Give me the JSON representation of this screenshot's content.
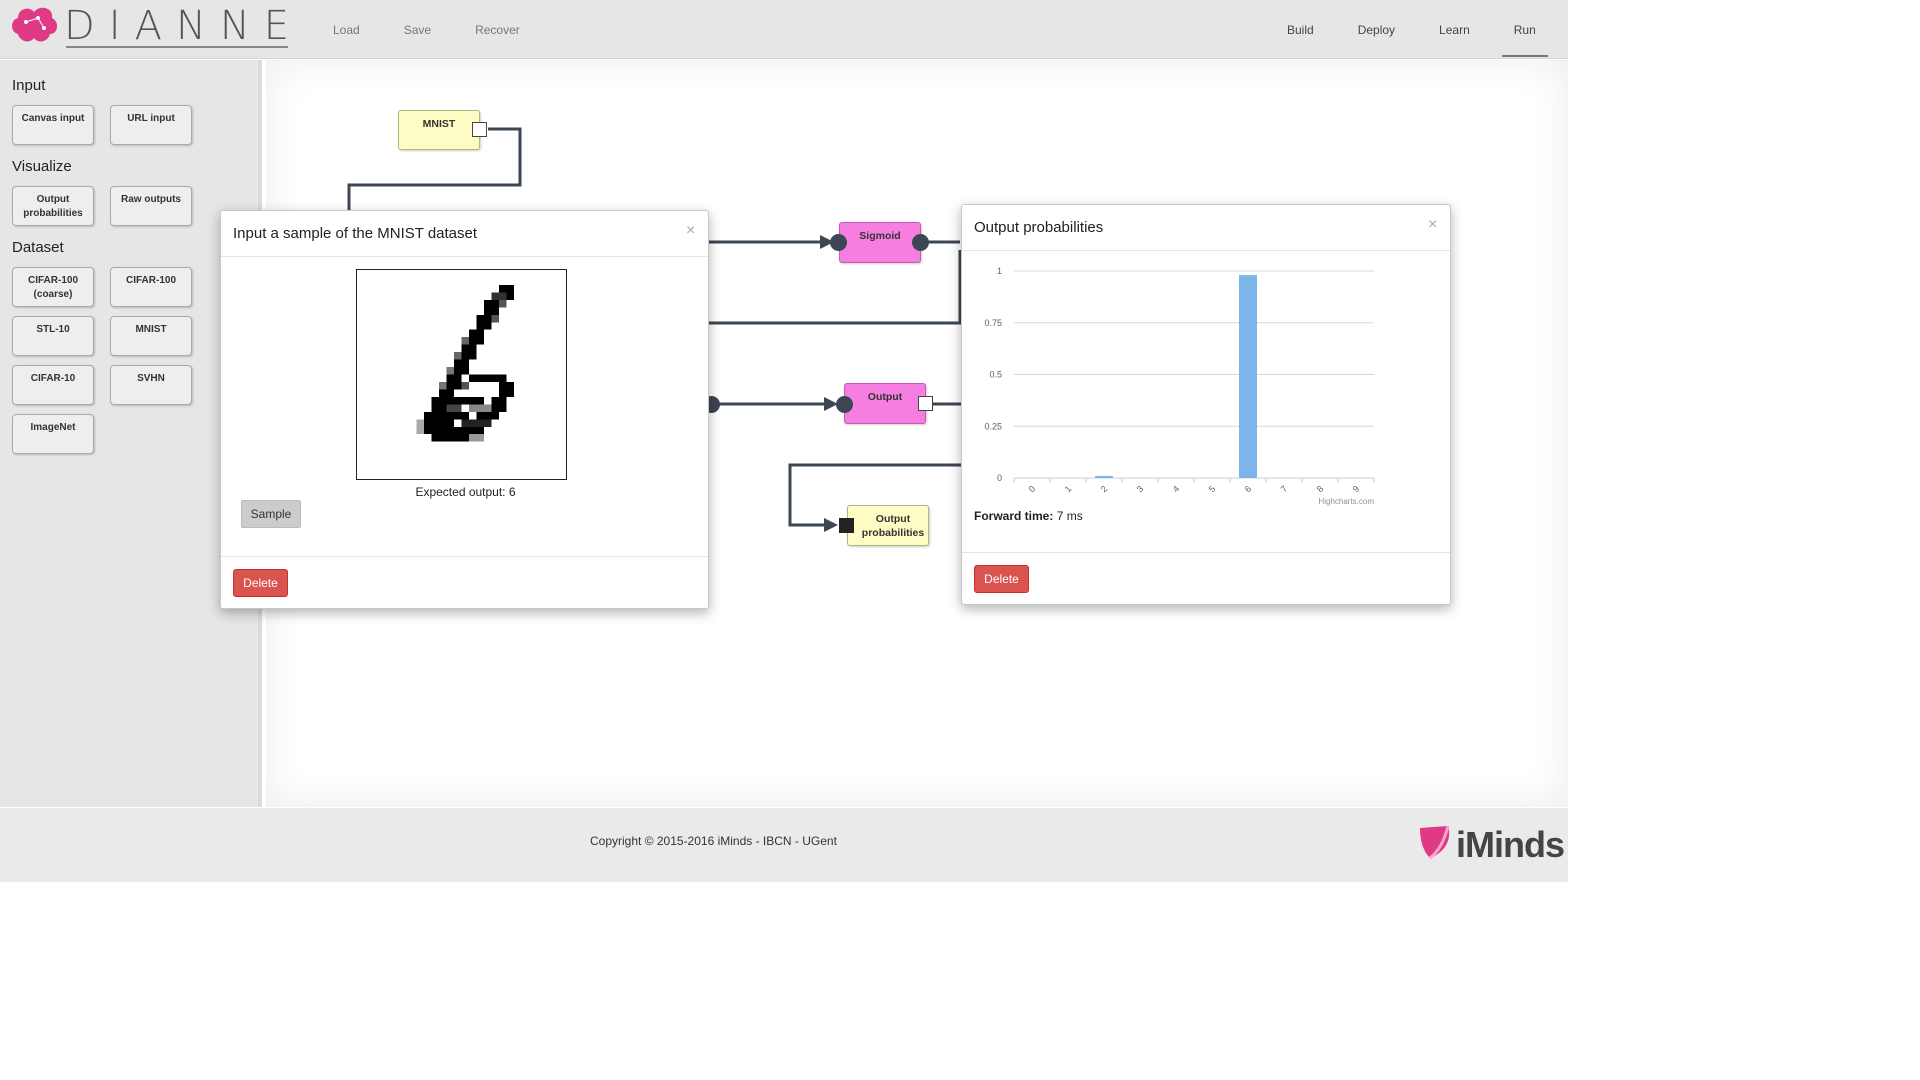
{
  "app": {
    "name": "DIANNE"
  },
  "nav": {
    "left": [
      "Load",
      "Save",
      "Recover"
    ],
    "right": [
      "Build",
      "Deploy",
      "Learn",
      "Run"
    ],
    "active": "Run"
  },
  "sidebar": {
    "sections": [
      {
        "title": "Input",
        "items": [
          "Canvas input",
          "URL input"
        ]
      },
      {
        "title": "Visualize",
        "items": [
          "Output probabilities",
          "Raw outputs"
        ]
      },
      {
        "title": "Dataset",
        "items": [
          "CIFAR-100 (coarse)",
          "CIFAR-100",
          "STL-10",
          "MNIST",
          "CIFAR-10",
          "SVHN",
          "ImageNet"
        ]
      }
    ]
  },
  "canvas": {
    "nodes": {
      "mnist": "MNIST",
      "sigmoid": "Sigmoid",
      "output": "Output",
      "output_prob": "Output probabilities"
    }
  },
  "sample_modal": {
    "title": "Input a sample of the MNIST dataset",
    "close": "×",
    "expected": "Expected output: 6",
    "sample_button": "Sample",
    "delete_button": "Delete"
  },
  "prob_modal": {
    "title": "Output probabilities",
    "close": "×",
    "forward_label": "Forward time:",
    "forward_value": "7 ms",
    "credit": "Highcharts.com",
    "delete_button": "Delete"
  },
  "chart_data": {
    "type": "bar",
    "categories": [
      "0",
      "1",
      "2",
      "3",
      "4",
      "5",
      "6",
      "7",
      "8",
      "9"
    ],
    "values": [
      0,
      0,
      0.01,
      0,
      0,
      0,
      0.98,
      0,
      0,
      0
    ],
    "ylim": [
      0,
      1
    ],
    "yticks": [
      "0",
      "0.25",
      "0.5",
      "0.75",
      "1"
    ],
    "bar_color": "#7cb5ec",
    "grid": true
  },
  "footer": {
    "copyright": "Copyright © 2015-2016 iMinds - IBCN - UGent",
    "brand": "iMinds"
  },
  "colors": {
    "delete": "#d9534f",
    "node_pink": "#f77ee1",
    "node_yellow": "#fdfcc4",
    "link": "#3d4653"
  }
}
